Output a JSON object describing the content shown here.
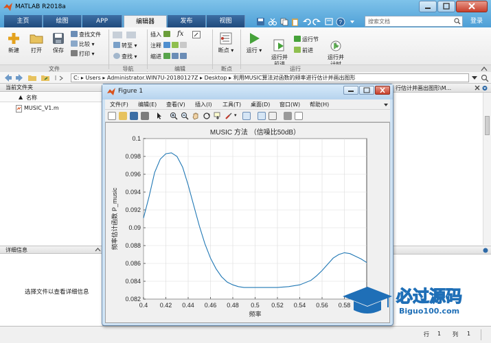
{
  "window": {
    "title": "MATLAB R2018a"
  },
  "tabs": [
    "主页",
    "绘图",
    "APP",
    "编辑器",
    "发布",
    "视图"
  ],
  "search": {
    "placeholder": "搜索文档"
  },
  "login": "登录",
  "ribbon": {
    "file": {
      "new": "新建",
      "open": "打开",
      "save": "保存",
      "find_files": "查找文件",
      "compare": "比较",
      "print": "打印",
      "group": "文件"
    },
    "nav": {
      "goto": "转至",
      "find": "查找",
      "group": "导航"
    },
    "edit": {
      "insert": "插入",
      "comment": "注释",
      "indent": "缩进",
      "fx": "fx",
      "group": "编辑"
    },
    "breakpoints": {
      "label": "断点",
      "group": "断点"
    },
    "run": {
      "run": "运行",
      "run_advance": "运行并\n前进",
      "run_section": "运行节",
      "advance": "前进",
      "run_time": "运行并\n计时",
      "group": "运行"
    }
  },
  "address": {
    "path": "C: ▸ Users ▸ Administrator.WIN7U-20180127Z ▸ Desktop ▸ 利用MUSIC算法对函数的频率进行估计并画出图形"
  },
  "left": {
    "header": "当前文件夹",
    "col_name": "名称",
    "sort": "▲",
    "file": "MUSIC_V1.m",
    "detail_header": "详细信息",
    "detail_msg": "选择文件以查看详细信息"
  },
  "right": {
    "header_text": "行估计并画出图形\\M..."
  },
  "status": {
    "row_label": "行",
    "row": "1",
    "col_label": "列",
    "col": "1"
  },
  "figure": {
    "title": "Figure 1",
    "menu": [
      "文件(F)",
      "编辑(E)",
      "查看(V)",
      "插入(I)",
      "工具(T)",
      "桌面(D)",
      "窗口(W)",
      "帮助(H)"
    ]
  },
  "watermark": {
    "text": "必过源码",
    "url": "Biguo100.com"
  },
  "colors": {
    "curve": "#1f77b4",
    "accent": "#2e6aa7",
    "wm": "#1f6fb7"
  },
  "chart_data": {
    "type": "line",
    "title": "MUSIC 方法 （信噪比50dB）",
    "xlabel": "频率",
    "ylabel": "频率估计函数 P_music",
    "xlim": [
      0.4,
      0.6
    ],
    "ylim": [
      0.082,
      0.1
    ],
    "xticks": [
      0.4,
      0.42,
      0.44,
      0.46,
      0.48,
      0.5,
      0.52,
      0.54,
      0.56,
      0.58
    ],
    "yticks": [
      0.082,
      0.084,
      0.086,
      0.088,
      0.09,
      0.092,
      0.094,
      0.096,
      0.098,
      0.1
    ],
    "grid": true,
    "x": [
      0.4,
      0.405,
      0.41,
      0.415,
      0.42,
      0.425,
      0.43,
      0.435,
      0.44,
      0.445,
      0.45,
      0.455,
      0.46,
      0.465,
      0.47,
      0.475,
      0.48,
      0.485,
      0.49,
      0.5,
      0.51,
      0.52,
      0.53,
      0.54,
      0.55,
      0.555,
      0.56,
      0.565,
      0.57,
      0.575,
      0.58,
      0.585,
      0.59,
      0.595,
      0.6
    ],
    "y": [
      0.0911,
      0.0935,
      0.0962,
      0.0977,
      0.0983,
      0.0984,
      0.098,
      0.0968,
      0.0948,
      0.0925,
      0.0902,
      0.0882,
      0.0866,
      0.0854,
      0.0845,
      0.0839,
      0.0836,
      0.0834,
      0.0833,
      0.0833,
      0.0833,
      0.0833,
      0.0834,
      0.0836,
      0.0841,
      0.0846,
      0.0852,
      0.0859,
      0.0866,
      0.087,
      0.0872,
      0.0871,
      0.0868,
      0.0865,
      0.0861
    ]
  }
}
